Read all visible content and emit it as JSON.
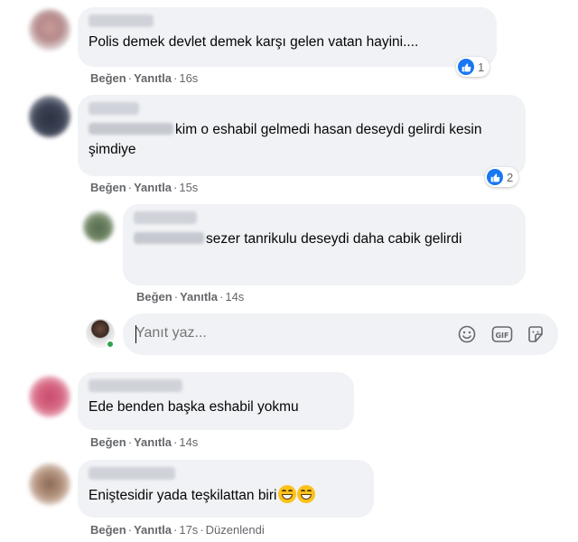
{
  "comments": [
    {
      "text": "Polis demek devlet demek karşı gelen vatan hayini....",
      "like_label": "Beğen",
      "reply_label": "Yanıtla",
      "time": "16s",
      "reaction_count": "1"
    },
    {
      "text": "kim o eshabil gelmedi hasan deseydi gelirdi kesin şimdiye",
      "like_label": "Beğen",
      "reply_label": "Yanıtla",
      "time": "15s",
      "reaction_count": "2"
    },
    {
      "text": "sezer tanrikulu deseydi daha cabik gelirdi",
      "like_label": "Beğen",
      "reply_label": "Yanıtla",
      "time": "14s"
    },
    {
      "text": "Ede benden başka eshabil yokmu",
      "like_label": "Beğen",
      "reply_label": "Yanıtla",
      "time": "14s"
    },
    {
      "text": "Eniştesidir yada teşkilattan biri",
      "like_label": "Beğen",
      "reply_label": "Yanıtla",
      "time": "17s",
      "edited_label": "Düzenlendi"
    }
  ],
  "reply_box": {
    "placeholder": "Yanıt yaz..."
  },
  "icons": {
    "emoji": "smile-icon",
    "gif": "gif-icon",
    "sticker": "sticker-icon",
    "like": "like-thumb-icon"
  },
  "colors": {
    "bubble": "#f0f2f5",
    "meta_text": "#65676b",
    "like_blue": "#1877f2",
    "online_green": "#31a24c"
  }
}
